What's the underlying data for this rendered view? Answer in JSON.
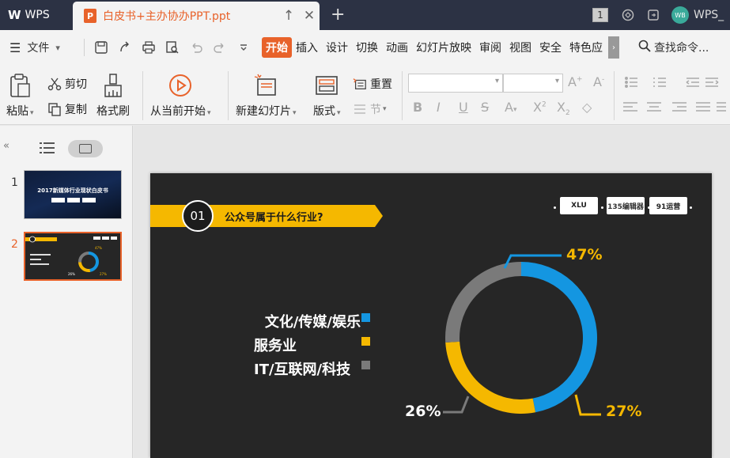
{
  "titlebar": {
    "app_name": "WPS",
    "doc_tab_icon": "P",
    "doc_title": "白皮书+主办协办PPT.ppt",
    "window_count": "1",
    "avatar_text": "WB",
    "user_name": "WPS_"
  },
  "menubar": {
    "file_label": "文件",
    "tabs": [
      {
        "label": "开始",
        "active": true
      },
      {
        "label": "插入"
      },
      {
        "label": "设计"
      },
      {
        "label": "切换"
      },
      {
        "label": "动画"
      },
      {
        "label": "幻灯片放映"
      },
      {
        "label": "审阅"
      },
      {
        "label": "视图"
      },
      {
        "label": "安全"
      },
      {
        "label": "特色应"
      }
    ],
    "search_label": "查找命令..."
  },
  "ribbon": {
    "paste": "粘贴",
    "cut": "剪切",
    "copy": "复制",
    "format_painter": "格式刷",
    "play_from_current": "从当前开始",
    "new_slide": "新建幻灯片",
    "layout": "版式",
    "reset": "重置",
    "section": "节"
  },
  "slides_panel": {
    "thumbnails": [
      {
        "number": "1",
        "title": "2017新媒体行业现状白皮书"
      },
      {
        "number": "2",
        "selected": true
      }
    ]
  },
  "slide": {
    "badge_number": "01",
    "heading": "公众号属于什么行业?",
    "logos": [
      "XLU",
      "135编辑器",
      "91运营"
    ],
    "colors": {
      "blue": "#1496e1",
      "yellow": "#f5b800",
      "gray": "#7a7a7a",
      "bg": "#262626"
    },
    "legend": [
      {
        "label": "文化/传媒/娱乐",
        "color": "#1496e1"
      },
      {
        "label": "服务业",
        "color": "#f5b800"
      },
      {
        "label": "IT/互联网/科技",
        "color": "#7a7a7a"
      }
    ]
  },
  "chart_data": {
    "type": "pie",
    "variant": "donut",
    "categories": [
      "文化/传媒/娱乐",
      "服务业",
      "IT/互联网/科技"
    ],
    "values": [
      47,
      27,
      26
    ],
    "labels": [
      "47%",
      "27%",
      "26%"
    ]
  }
}
